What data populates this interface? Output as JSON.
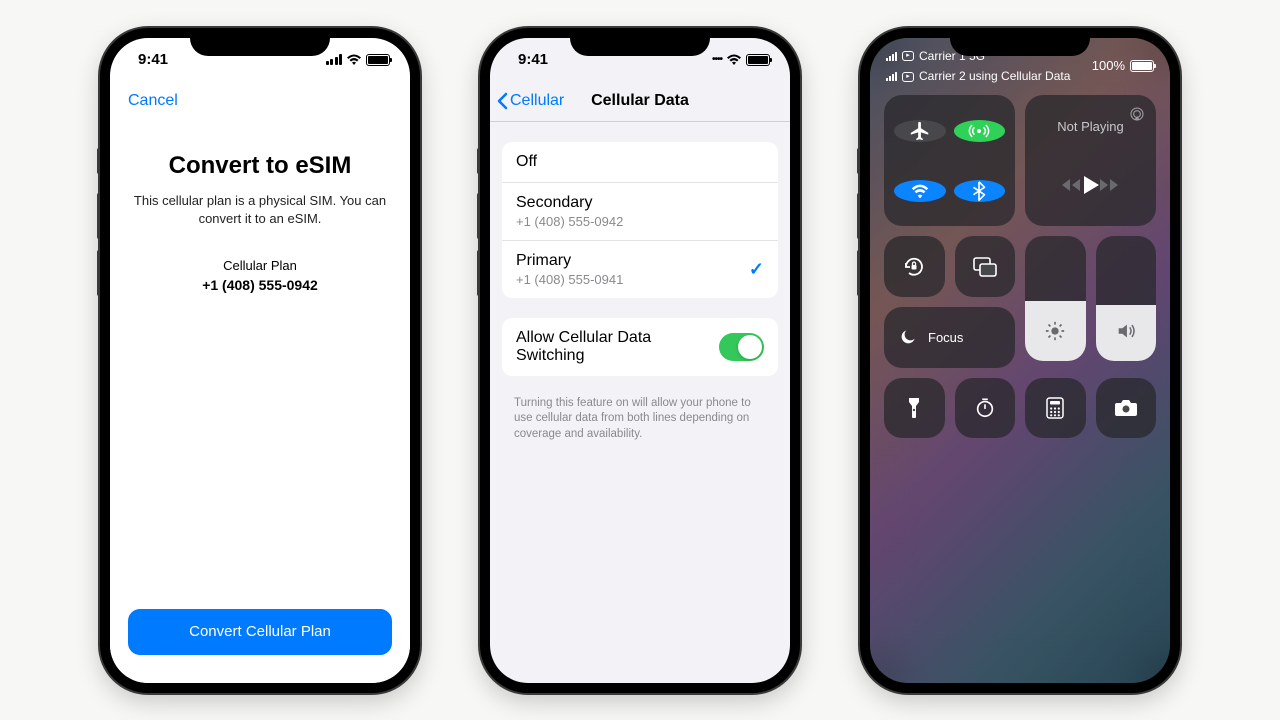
{
  "status_time": "9:41",
  "phone1": {
    "cancel": "Cancel",
    "title": "Convert to eSIM",
    "subtitle": "This cellular plan is a physical SIM. You can convert it to an eSIM.",
    "plan_label": "Cellular Plan",
    "phone": "+1 (408) 555-0942",
    "button": "Convert Cellular Plan"
  },
  "phone2": {
    "back": "Cellular",
    "title": "Cellular Data",
    "rows": [
      {
        "label": "Off",
        "sub": "",
        "checked": false
      },
      {
        "label": "Secondary",
        "sub": "+1 (408) 555-0942",
        "checked": false
      },
      {
        "label": "Primary",
        "sub": "+1 (408) 555-0941",
        "checked": true
      }
    ],
    "switch_label": "Allow Cellular Data Switching",
    "switch_on": true,
    "footer": "Turning this feature on will allow your phone to use cellular data from both lines depending on coverage and availability."
  },
  "phone3": {
    "carrier1": "Carrier 1 5G",
    "carrier2": "Carrier 2 using Cellular Data",
    "battery": "100%",
    "media": "Not Playing",
    "focus": "Focus",
    "brightness_pct": 48,
    "volume_pct": 45
  }
}
